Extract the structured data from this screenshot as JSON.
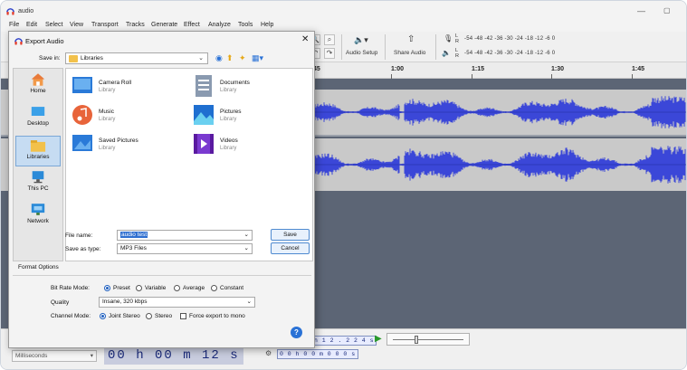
{
  "app": {
    "title": "audio",
    "window_controls": {
      "minimize": "—",
      "maximize": "▢"
    }
  },
  "menu": {
    "items": [
      "File",
      "Edit",
      "Select",
      "View",
      "Transport",
      "Tracks",
      "Generate",
      "Effect",
      "Analyze",
      "Tools",
      "Help"
    ]
  },
  "toolbar": {
    "audio_setup_label": "Audio Setup",
    "share_audio_label": "Share Audio",
    "meter_scale": "-54  -48  -42  -36  -30  -24  -18  -12   -6",
    "meter_scale_2": "-54  -48  -42  -36  -30  -24  -18  -12   -6",
    "meter_tail_1": "0",
    "meter_tail_2": "0",
    "lr_l": "L",
    "lr_r": "R"
  },
  "timeline": {
    "labels": [
      "45",
      "1:00",
      "1:15",
      "1:30",
      "1:45"
    ]
  },
  "bottom": {
    "units": "Milliseconds",
    "time_big": "00 h 00 m 12 s",
    "sel_start": "h 1 2 . 2 2 4 s",
    "sel_end": "0 0 h 0 0 m 0 0 0 s"
  },
  "dialog": {
    "title": "Export Audio",
    "save_in_label": "Save in:",
    "save_in_value": "Libraries",
    "places": [
      {
        "label": "Home",
        "icon": "home-icon"
      },
      {
        "label": "Desktop",
        "icon": "desktop-icon"
      },
      {
        "label": "Libraries",
        "icon": "libraries-icon"
      },
      {
        "label": "This PC",
        "icon": "this-pc-icon"
      },
      {
        "label": "Network",
        "icon": "network-icon"
      }
    ],
    "files": [
      {
        "name": "Camera Roll",
        "type": "Library",
        "icon": "camera-roll-icon"
      },
      {
        "name": "Documents",
        "type": "Library",
        "icon": "documents-icon"
      },
      {
        "name": "Music",
        "type": "Library",
        "icon": "music-icon"
      },
      {
        "name": "Pictures",
        "type": "Library",
        "icon": "pictures-icon"
      },
      {
        "name": "Saved Pictures",
        "type": "Library",
        "icon": "saved-pictures-icon"
      },
      {
        "name": "Videos",
        "type": "Library",
        "icon": "videos-icon"
      }
    ],
    "file_name_label": "File name:",
    "file_name_value": "audio test",
    "save_as_type_label": "Save as type:",
    "save_as_type_value": "MP3 Files",
    "save_button": "Save",
    "cancel_button": "Cancel",
    "format_options_title": "Format Options",
    "bit_rate_mode_label": "Bit Rate Mode:",
    "bit_rate_options": [
      "Preset",
      "Variable",
      "Average",
      "Constant"
    ],
    "bit_rate_selected": "Preset",
    "quality_label": "Quality",
    "quality_value": "Insane, 320 kbps",
    "channel_mode_label": "Channel Mode:",
    "channel_options": [
      "Joint Stereo",
      "Stereo"
    ],
    "channel_selected": "Joint Stereo",
    "force_mono_label": "Force export to mono",
    "help": "?"
  },
  "colors": {
    "waveform": "#3b47d8",
    "track_bg": "#c9c9c9",
    "track_area": "#5c6575",
    "accent": "#2a72d6"
  }
}
